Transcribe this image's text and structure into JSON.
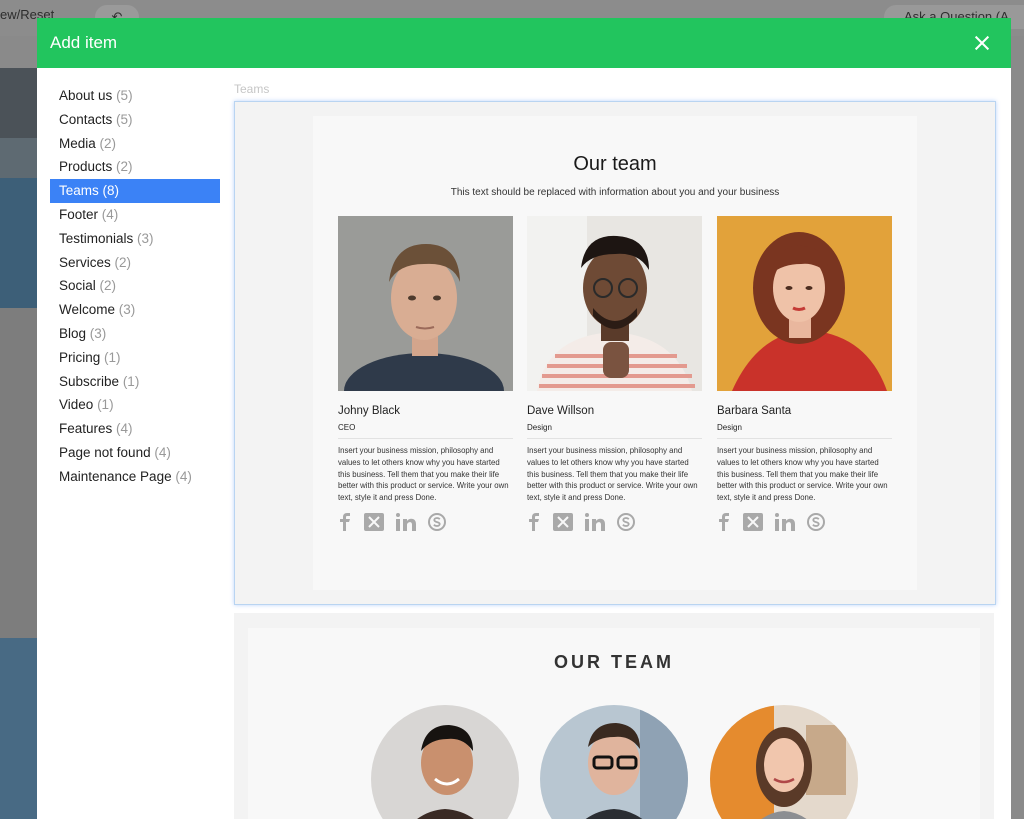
{
  "background": {
    "view_menu": "ew/Reset",
    "undo_icon": "undo-icon",
    "ask_button": "Ask a Question (A"
  },
  "modal": {
    "title": "Add item",
    "close_icon": "close-icon",
    "header_color": "#22c55e",
    "active_color": "#3b82f6"
  },
  "categories": [
    {
      "label": "About us",
      "count": "(5)"
    },
    {
      "label": "Contacts",
      "count": "(5)"
    },
    {
      "label": "Media",
      "count": "(2)"
    },
    {
      "label": "Products",
      "count": "(2)"
    },
    {
      "label": "Teams",
      "count": "(8)",
      "active": true
    },
    {
      "label": "Footer",
      "count": "(4)"
    },
    {
      "label": "Testimonials",
      "count": "(3)"
    },
    {
      "label": "Services",
      "count": "(2)"
    },
    {
      "label": "Social",
      "count": "(2)"
    },
    {
      "label": "Welcome",
      "count": "(3)"
    },
    {
      "label": "Blog",
      "count": "(3)"
    },
    {
      "label": "Pricing",
      "count": "(1)"
    },
    {
      "label": "Subscribe",
      "count": "(1)"
    },
    {
      "label": "Video",
      "count": "(1)"
    },
    {
      "label": "Features",
      "count": "(4)"
    },
    {
      "label": "Page not found",
      "count": "(4)"
    },
    {
      "label": "Maintenance Page",
      "count": "(4)"
    }
  ],
  "section_label": "Teams",
  "preview1": {
    "title": "Our team",
    "subtitle": "This text should be replaced with information about you and your business",
    "members": [
      {
        "name": "Johny Black",
        "role": "CEO",
        "desc": "Insert your business mission, philosophy and values to let others know why you have started this business. Tell them that you make their life better with this product or service. Write your own text, style it and press Done."
      },
      {
        "name": "Dave Willson",
        "role": "Design",
        "desc": "Insert your business mission, philosophy and values to let others know why you have started this business. Tell them that you make their life better with this product or service. Write your own text, style it and press Done."
      },
      {
        "name": "Barbara Santa",
        "role": "Design",
        "desc": "Insert your business mission, philosophy and values to let others know why you have started this business. Tell them that you make their life better with this product or service. Write your own text, style it and press Done."
      }
    ],
    "social_icons": [
      "facebook-icon",
      "x-icon",
      "linkedin-icon",
      "skype-icon"
    ]
  },
  "preview2": {
    "title": "OUR TEAM"
  }
}
